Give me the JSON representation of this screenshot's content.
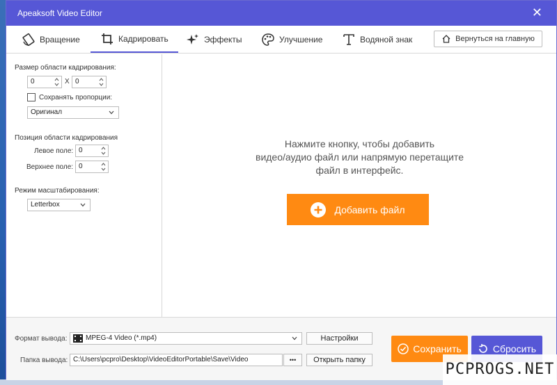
{
  "window": {
    "title": "Apeaksoft Video Editor"
  },
  "tabs": [
    {
      "label": "Вращение",
      "icon": "rotate-icon"
    },
    {
      "label": "Кадрировать",
      "icon": "crop-icon",
      "active": true
    },
    {
      "label": "Эффекты",
      "icon": "effects-sparkle-icon"
    },
    {
      "label": "Улучшение",
      "icon": "palette-icon"
    },
    {
      "label": "Водяной знак",
      "icon": "text-t-icon"
    }
  ],
  "home_button": {
    "label": "Вернуться на главную",
    "icon": "home-icon"
  },
  "crop": {
    "size_label": "Размер области кадрирования:",
    "width": "0",
    "separator": "X",
    "height": "0",
    "keep_ratio_label": "Сохранять пропорции:",
    "keep_ratio_checked": false,
    "ratio_value": "Оригинал",
    "position_label": "Позиция области кадрирования",
    "left_label": "Левое поле:",
    "left_value": "0",
    "top_label": "Верхнее поле:",
    "top_value": "0",
    "zoom_label": "Режим масштабирования:",
    "zoom_value": "Letterbox"
  },
  "work": {
    "prompt_lines": [
      "Нажмите кнопку, чтобы добавить",
      "видео/аудио файл или напрямую перетащите",
      "файл в интерфейс."
    ],
    "add_button": "Добавить файл"
  },
  "output": {
    "format_label": "Формат вывода:",
    "format_value": "MPEG-4 Video (*.mp4)",
    "settings_button": "Настройки",
    "folder_label": "Папка вывода:",
    "folder_value": "C:\\Users\\pcpro\\Desktop\\VideoEditorPortable\\Save\\Video",
    "browse_button": "•••",
    "open_folder_button": "Открыть папку",
    "save_button": "Сохранить",
    "reset_button": "Сбросить"
  },
  "watermark_text": "PCPROGS.NET",
  "colors": {
    "accent": "#5657d6",
    "orange": "#ff8a12"
  }
}
